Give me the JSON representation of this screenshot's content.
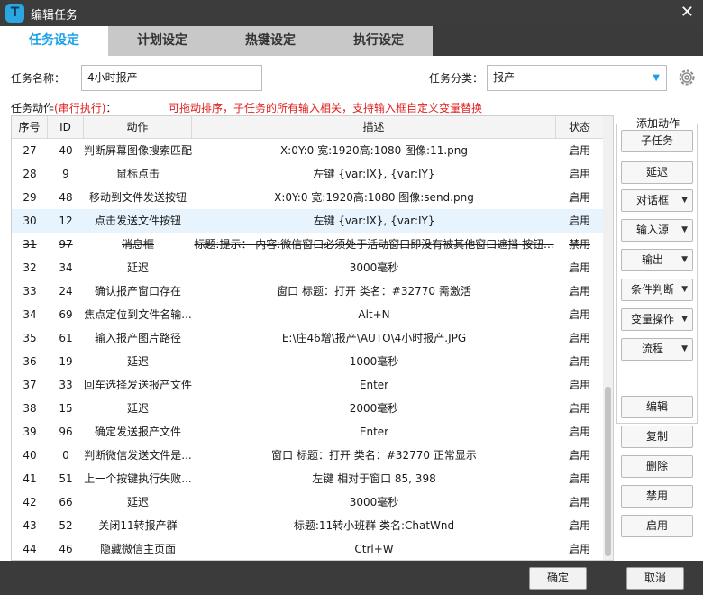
{
  "window": {
    "title": "编辑任务",
    "close_glyph": "✕",
    "icon_letter": "T"
  },
  "tabs": [
    {
      "label": "任务设定"
    },
    {
      "label": "计划设定"
    },
    {
      "label": "热键设定"
    },
    {
      "label": "执行设定"
    }
  ],
  "form": {
    "task_name_label": "任务名称：",
    "task_name_value": "4小时报产",
    "category_label": "任务分类：",
    "category_value": "报产",
    "actions_label": "任务动作",
    "actions_mode": "(串行执行)",
    "actions_label_suffix": "：",
    "hint": "可拖动排序，子任务的所有输入相关，支持输入框自定义变量替换"
  },
  "table": {
    "headers": [
      "序号",
      "ID",
      "动作",
      "描述",
      "状态"
    ],
    "rows": [
      {
        "seq": "27",
        "id": "40",
        "action": "判断屏幕图像搜索匹配",
        "desc": "X:0Y:0 宽:1920高:1080 图像:11.png",
        "state": "启用"
      },
      {
        "seq": "28",
        "id": "9",
        "action": "鼠标点击",
        "desc": "左键 {var:IX}, {var:IY}",
        "state": "启用"
      },
      {
        "seq": "29",
        "id": "48",
        "action": "移动到文件发送按钮",
        "desc": "X:0Y:0 宽:1920高:1080 图像:send.png",
        "state": "启用"
      },
      {
        "seq": "30",
        "id": "12",
        "action": "点击发送文件按钮",
        "desc": "左键 {var:IX}, {var:IY}",
        "state": "启用",
        "selected": true
      },
      {
        "seq": "31",
        "id": "97",
        "action": "消息框",
        "desc": "标题:提示： 内容:微信窗口必须处于活动窗口即没有被其他窗口遮挡 按钮...",
        "state": "禁用",
        "disabled": true
      },
      {
        "seq": "32",
        "id": "34",
        "action": "延迟",
        "desc": "3000毫秒",
        "state": "启用"
      },
      {
        "seq": "33",
        "id": "24",
        "action": "确认报产窗口存在",
        "desc": "窗口 标题：打开 类名：#32770 需激活",
        "state": "启用"
      },
      {
        "seq": "34",
        "id": "69",
        "action": "焦点定位到文件名输...",
        "desc": "Alt+N",
        "state": "启用"
      },
      {
        "seq": "35",
        "id": "61",
        "action": "输入报产图片路径",
        "desc": "E:\\庄46增\\报产\\AUTO\\4小时报产.JPG",
        "state": "启用"
      },
      {
        "seq": "36",
        "id": "19",
        "action": "延迟",
        "desc": "1000毫秒",
        "state": "启用"
      },
      {
        "seq": "37",
        "id": "33",
        "action": "回车选择发送报产文件",
        "desc": "Enter",
        "state": "启用"
      },
      {
        "seq": "38",
        "id": "15",
        "action": "延迟",
        "desc": "2000毫秒",
        "state": "启用"
      },
      {
        "seq": "39",
        "id": "96",
        "action": "确定发送报产文件",
        "desc": "Enter",
        "state": "启用"
      },
      {
        "seq": "40",
        "id": "0",
        "action": "判断微信发送文件是...",
        "desc": "窗口 标题：打开 类名：#32770 正常显示",
        "state": "启用"
      },
      {
        "seq": "41",
        "id": "51",
        "action": "上一个按键执行失败...",
        "desc": "左键 相对于窗口 85, 398",
        "state": "启用"
      },
      {
        "seq": "42",
        "id": "66",
        "action": "延迟",
        "desc": "3000毫秒",
        "state": "启用"
      },
      {
        "seq": "43",
        "id": "52",
        "action": "关闭11转报产群",
        "desc": "标题:11转小班群 类名:ChatWnd",
        "state": "启用"
      },
      {
        "seq": "44",
        "id": "46",
        "action": "隐藏微信主页面",
        "desc": "Ctrl+W",
        "state": "启用"
      }
    ]
  },
  "sidebar": {
    "group_title": "添加动作",
    "add_buttons": [
      {
        "label": "子任务",
        "dropdown": false
      },
      {
        "label": "延迟",
        "dropdown": false
      },
      {
        "label": "对话框",
        "dropdown": true
      },
      {
        "label": "输入源",
        "dropdown": true
      },
      {
        "label": "输出",
        "dropdown": true
      },
      {
        "label": "条件判断",
        "dropdown": true
      },
      {
        "label": "变量操作",
        "dropdown": true
      },
      {
        "label": "流程",
        "dropdown": true
      }
    ],
    "edit_buttons": [
      {
        "label": "编辑"
      },
      {
        "label": "复制"
      },
      {
        "label": "删除"
      },
      {
        "label": "禁用"
      },
      {
        "label": "启用"
      }
    ],
    "caret_glyph": "▼"
  },
  "footer": {
    "ok_label": "确定",
    "cancel_label": "取消"
  },
  "colors": {
    "accent": "#1aa0e8",
    "hint_red": "#e02020",
    "selected_row": "#e8f4fd",
    "titlebar": "#3c3c3c"
  }
}
